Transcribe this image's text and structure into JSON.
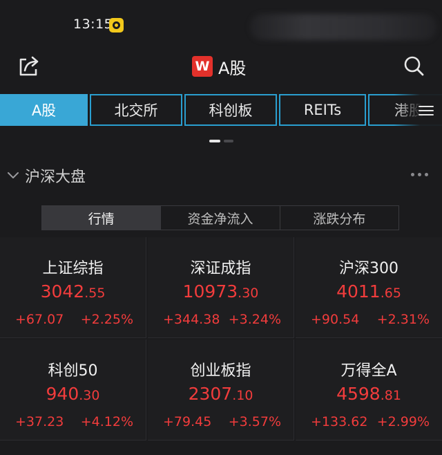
{
  "status_bar": {
    "time": "13:15"
  },
  "header": {
    "title": "A股",
    "logo_text": "W"
  },
  "tabs": [
    {
      "label": "A股",
      "active": true
    },
    {
      "label": "北交所",
      "active": false
    },
    {
      "label": "科创板",
      "active": false
    },
    {
      "label": "REITs",
      "active": false
    },
    {
      "label": "港股",
      "active": false
    }
  ],
  "section": {
    "title": "沪深大盘"
  },
  "subtabs": [
    {
      "label": "行情",
      "active": true
    },
    {
      "label": "资金净流入",
      "active": false
    },
    {
      "label": "涨跌分布",
      "active": false
    }
  ],
  "indices": [
    {
      "name": "上证综指",
      "price_int": "3042",
      "price_dec": ".55",
      "change": "+67.07",
      "pct": "+2.25%"
    },
    {
      "name": "深证成指",
      "price_int": "10973",
      "price_dec": ".30",
      "change": "+344.38",
      "pct": "+3.24%"
    },
    {
      "name": "沪深300",
      "price_int": "4011",
      "price_dec": ".65",
      "change": "+90.54",
      "pct": "+2.31%"
    },
    {
      "name": "科创50",
      "price_int": "940",
      "price_dec": ".30",
      "change": "+37.23",
      "pct": "+4.12%"
    },
    {
      "name": "创业板指",
      "price_int": "2307",
      "price_dec": ".10",
      "change": "+79.45",
      "pct": "+3.57%"
    },
    {
      "name": "万得全A",
      "price_int": "4598",
      "price_dec": ".81",
      "change": "+133.62",
      "pct": "+2.99%"
    }
  ],
  "colors": {
    "accent": "#39a7d6",
    "up": "#f23c3c",
    "brand": "#e3312b"
  },
  "icons": [
    "share-icon",
    "search-icon",
    "menu-icon",
    "chevron-down-icon",
    "more-icon"
  ]
}
